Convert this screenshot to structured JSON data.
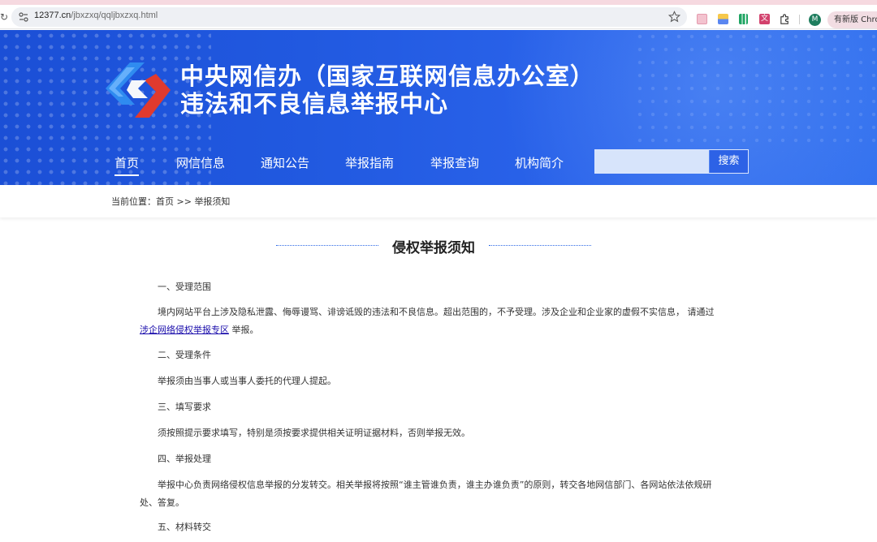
{
  "browser": {
    "url_host": "12377.cn",
    "url_path": "/jbxzxq/qqljbxzxq.html",
    "avatar_letter": "M",
    "update_label": "有新版 Chrome",
    "ext_4_label": "文"
  },
  "header": {
    "title_line1": "中央网信办（国家互联网信息办公室）",
    "title_line2": "违法和不良信息举报中心",
    "brand_colors": {
      "primary": "#2159e0",
      "logo_blue": "#2f8bf0",
      "logo_red": "#e03a2e"
    }
  },
  "nav": {
    "items": [
      {
        "label": "首页",
        "active": true
      },
      {
        "label": "网信信息"
      },
      {
        "label": "通知公告"
      },
      {
        "label": "举报指南"
      },
      {
        "label": "举报查询"
      },
      {
        "label": "机构简介"
      }
    ],
    "search_placeholder": "",
    "search_button": "搜索"
  },
  "breadcrumb": {
    "prefix": "当前位置：",
    "home": "首页",
    "separator": " >> ",
    "current": "举报须知"
  },
  "page": {
    "title": "侵权举报须知",
    "sections": [
      {
        "heading": "一、受理范围",
        "body_pre": "境内网站平台上涉及隐私泄露、侮辱谩骂、诽谤诋毁的违法和不良信息。超出范围的，不予受理。涉及企业和企业家的虚假不实信息， 请通过",
        "link": "涉企网络侵权举报专区",
        "body_post": " 举报。"
      },
      {
        "heading": "二、受理条件",
        "body": "举报须由当事人或当事人委托的代理人提起。"
      },
      {
        "heading": "三、填写要求",
        "body": "须按照提示要求填写，特别是须按要求提供相关证明证据材料，否则举报无效。"
      },
      {
        "heading": "四、举报处理",
        "body": "举报中心负责网络侵权信息举报的分发转交。相关举报将按照“谁主管谁负责，谁主办谁负责”的原则，转交各地网信部门、各网站依法依规研处、答复。"
      },
      {
        "heading": "五、材料转交"
      }
    ]
  }
}
